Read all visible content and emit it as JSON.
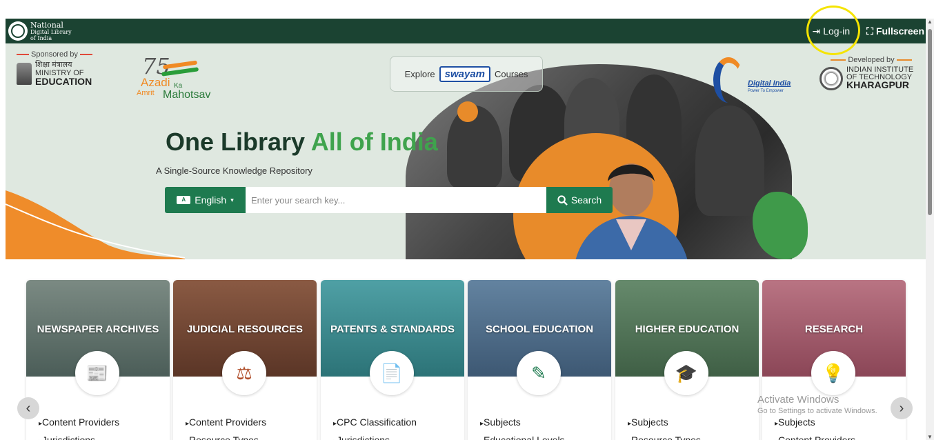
{
  "topbar": {
    "logo_line1": "National",
    "logo_line2": "Digital Library",
    "logo_line3": "of India",
    "login_label": "Log-in",
    "fullscreen_label": "Fullscreen"
  },
  "hero": {
    "sponsor_label": "Sponsored by",
    "ministry_hindi": "शिक्षा मंत्रालय",
    "ministry_line1": "MINISTRY OF",
    "ministry_line2": "EDUCATION",
    "azadi_num": "75",
    "azadi_line1": "Azadi",
    "azadi_ka": "Ka",
    "azadi_amrit": "Amrit",
    "azadi_mahotsav": "Mahotsav",
    "explore_label": "Explore",
    "swayam_label": "swayam",
    "courses_label": "Courses",
    "digital_india": "Digital India",
    "digital_india_sub": "Power To Empower",
    "developed_label": "Developed by",
    "iit_line1": "INDIAN INSTITUTE",
    "iit_line2": "OF TECHNOLOGY",
    "iit_line3": "KHARAGPUR",
    "title_part1": "One Library ",
    "title_part2": "All of India",
    "subtitle": "A Single-Source Knowledge Repository",
    "language_label": "English",
    "search_placeholder": "Enter your search key...",
    "search_button": "Search"
  },
  "cards": [
    {
      "title": "NEWSPAPER ARCHIVES",
      "link1": "Content Providers",
      "link2": "Jurisdictions",
      "color": "#5d6f6a",
      "icon": "newspaper-icon"
    },
    {
      "title": "JUDICIAL RESOURCES",
      "link1": "Content Providers",
      "link2": "Resource Types",
      "color": "#6e4433",
      "icon": "scales-icon"
    },
    {
      "title": "PATENTS & STANDARDS",
      "link1": "CPC Classification",
      "link2": "Jurisdictions",
      "color": "#3d8a8f",
      "icon": "patent-icon"
    },
    {
      "title": "SCHOOL EDUCATION",
      "link1": "Subjects",
      "link2": "Educational Levels",
      "color": "#4d6a86",
      "icon": "pencil-cup-icon"
    },
    {
      "title": "HIGHER EDUCATION",
      "link1": "Subjects",
      "link2": "Resource Types",
      "color": "#4f7356",
      "icon": "graduate-icon"
    },
    {
      "title": "RESEARCH",
      "link1": "Subjects",
      "link2": "Content Providers",
      "color": "#a55e6d",
      "icon": "idea-icon"
    }
  ],
  "carousel": {
    "prev": "‹",
    "next": "›"
  },
  "watermark": {
    "line1": "Activate Windows",
    "line2": "Go to Settings to activate Windows."
  }
}
